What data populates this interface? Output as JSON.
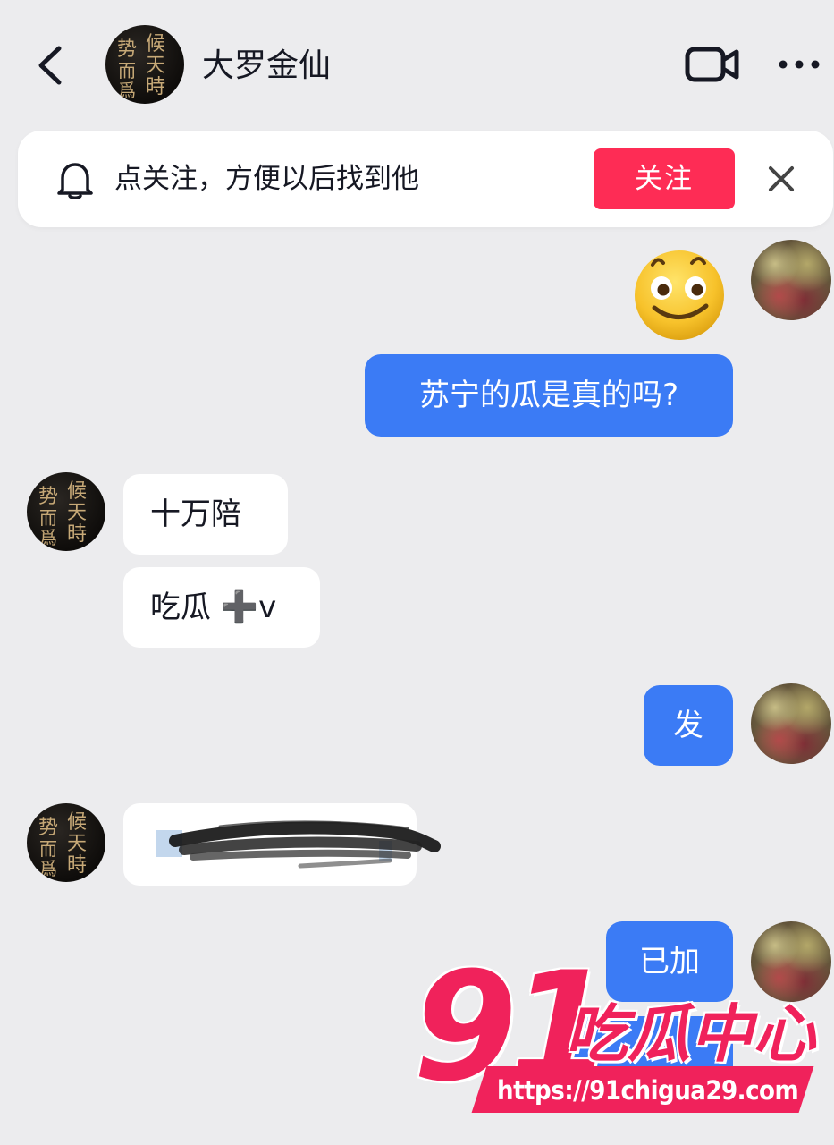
{
  "header": {
    "contact_name": "大罗金仙",
    "avatar_calligraphy": [
      "势",
      "候",
      "而",
      "天",
      "爲",
      "時"
    ]
  },
  "follow_banner": {
    "text": "点关注，方便以后找到他",
    "follow_label": "关注"
  },
  "messages": [
    {
      "side": "right",
      "type": "emoji",
      "content": "smiling-face"
    },
    {
      "side": "right",
      "type": "text",
      "text": "苏宁的瓜是真的吗?"
    },
    {
      "side": "left",
      "type": "text",
      "text": "十万陪"
    },
    {
      "side": "left",
      "type": "text",
      "text": "吃瓜 ➕v"
    },
    {
      "side": "right",
      "type": "text",
      "text": "发"
    },
    {
      "side": "left",
      "type": "redacted",
      "text": ""
    },
    {
      "side": "right",
      "type": "text",
      "text": "已加"
    }
  ],
  "watermark": {
    "number": "91",
    "title": "吃瓜中心",
    "url": "https://91chigua29.com"
  },
  "colors": {
    "background": "#ececee",
    "outgoing_bubble": "#3b7bf5",
    "incoming_bubble": "#ffffff",
    "follow_button": "#fe2c55",
    "watermark": "#f0225b"
  }
}
